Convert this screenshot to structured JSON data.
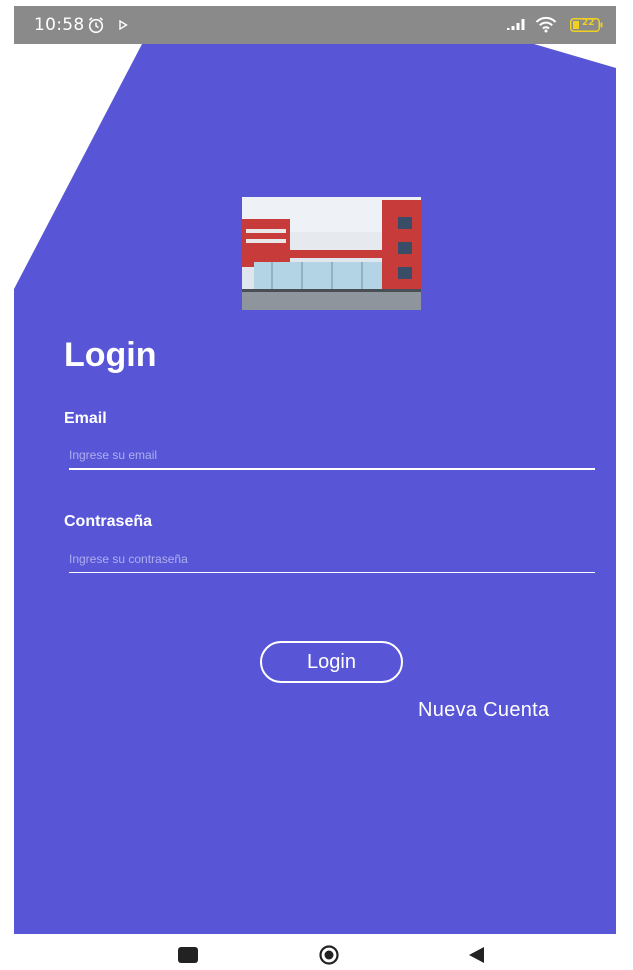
{
  "status_bar": {
    "time": "10:58",
    "battery_level": "22"
  },
  "login": {
    "title": "Login",
    "email": {
      "label": "Email",
      "placeholder": "Ingrese su email",
      "value": ""
    },
    "password": {
      "label": "Contraseña",
      "placeholder": "Ingrese su contraseña",
      "value": ""
    },
    "submit_label": "Login",
    "new_account_label": "Nueva Cuenta"
  },
  "colors": {
    "primary": "#5856d6",
    "status_bar": "#8a8a8a",
    "text_on_primary": "#ffffff"
  },
  "icons": {
    "status": [
      "alarm-icon",
      "play-icon",
      "signal-icon",
      "wifi-icon",
      "battery-icon"
    ],
    "navigation": [
      "recents-icon",
      "home-icon",
      "back-icon"
    ]
  }
}
